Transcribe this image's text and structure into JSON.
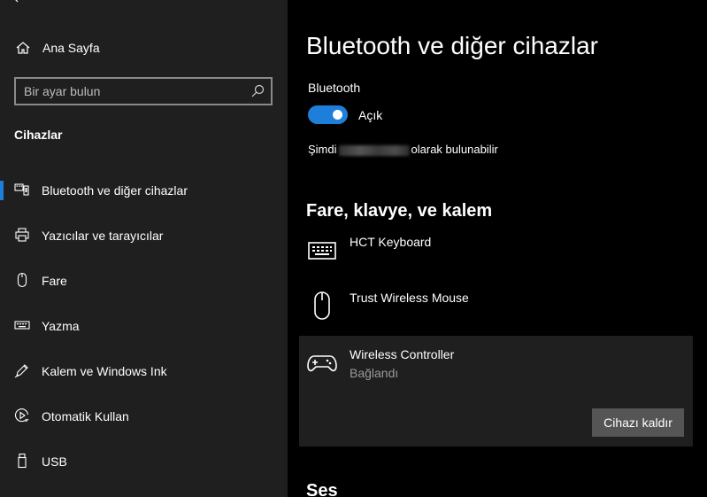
{
  "sidebar": {
    "home_label": "Ana Sayfa",
    "search_placeholder": "Bir ayar bulun",
    "section_title": "Cihazlar",
    "items": [
      {
        "label": "Bluetooth ve diğer cihazlar",
        "icon": "bluetooth-devices-icon",
        "selected": true
      },
      {
        "label": "Yazıcılar ve tarayıcılar",
        "icon": "printer-icon",
        "selected": false
      },
      {
        "label": "Fare",
        "icon": "mouse-icon",
        "selected": false
      },
      {
        "label": "Yazma",
        "icon": "keyboard-icon",
        "selected": false
      },
      {
        "label": "Kalem ve Windows Ink",
        "icon": "pen-icon",
        "selected": false
      },
      {
        "label": "Otomatik Kullan",
        "icon": "autoplay-icon",
        "selected": false
      },
      {
        "label": "USB",
        "icon": "usb-icon",
        "selected": false
      }
    ]
  },
  "main": {
    "title": "Bluetooth ve diğer cihazlar",
    "bluetooth": {
      "label": "Bluetooth",
      "toggle_on": true,
      "toggle_state_label": "Açık",
      "discoverable_prefix": "Şimdi",
      "discoverable_suffix": "olarak bulunabilir"
    },
    "group_title": "Fare, klavye, ve kalem",
    "devices": [
      {
        "name": "HCT Keyboard",
        "status": "",
        "icon": "keyboard-icon"
      },
      {
        "name": "Trust Wireless Mouse",
        "status": "",
        "icon": "mouse-icon"
      },
      {
        "name": "Wireless Controller",
        "status": "Bağlandı",
        "icon": "gamepad-icon",
        "selected": true
      }
    ],
    "remove_button": "Cihazı kaldır",
    "next_group_title": "Ses"
  },
  "colors": {
    "accent": "#1e7fdb",
    "sidebar_bg": "#1f1f1f",
    "main_bg": "#000000",
    "button_bg": "#555555"
  }
}
